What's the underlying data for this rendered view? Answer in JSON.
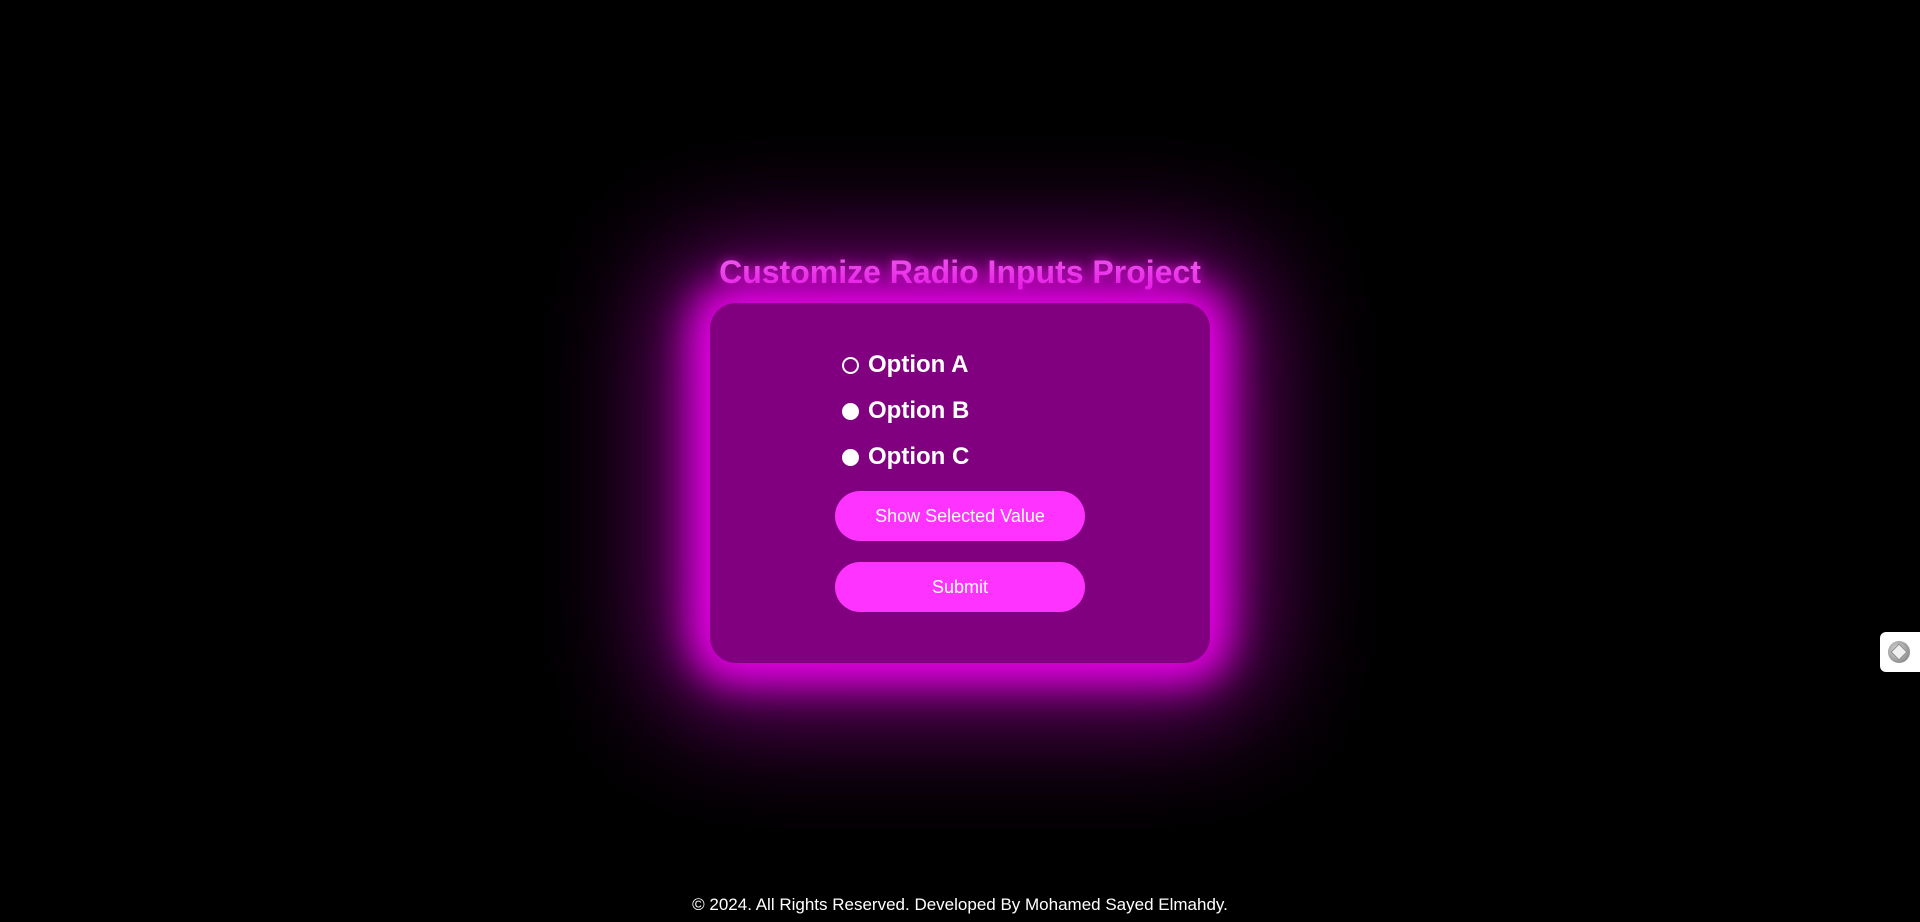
{
  "page": {
    "title": "Customize Radio Inputs Project"
  },
  "options": [
    {
      "label": "Option A",
      "selected": false
    },
    {
      "label": "Option B",
      "selected": false
    },
    {
      "label": "Option C",
      "selected": false
    }
  ],
  "buttons": {
    "show_label": "Show Selected Value",
    "submit_label": "Submit"
  },
  "footer": {
    "text": "© 2024. All Rights Reserved. Developed By Mohamed Sayed Elmahdy."
  },
  "widget": {
    "icon": "extension-widget-icon"
  },
  "colors": {
    "background": "#000000",
    "card": "#800080",
    "glow": "#e600e6",
    "title": "#ff80ff",
    "button": "#ff33ff",
    "text": "#ffffff"
  }
}
